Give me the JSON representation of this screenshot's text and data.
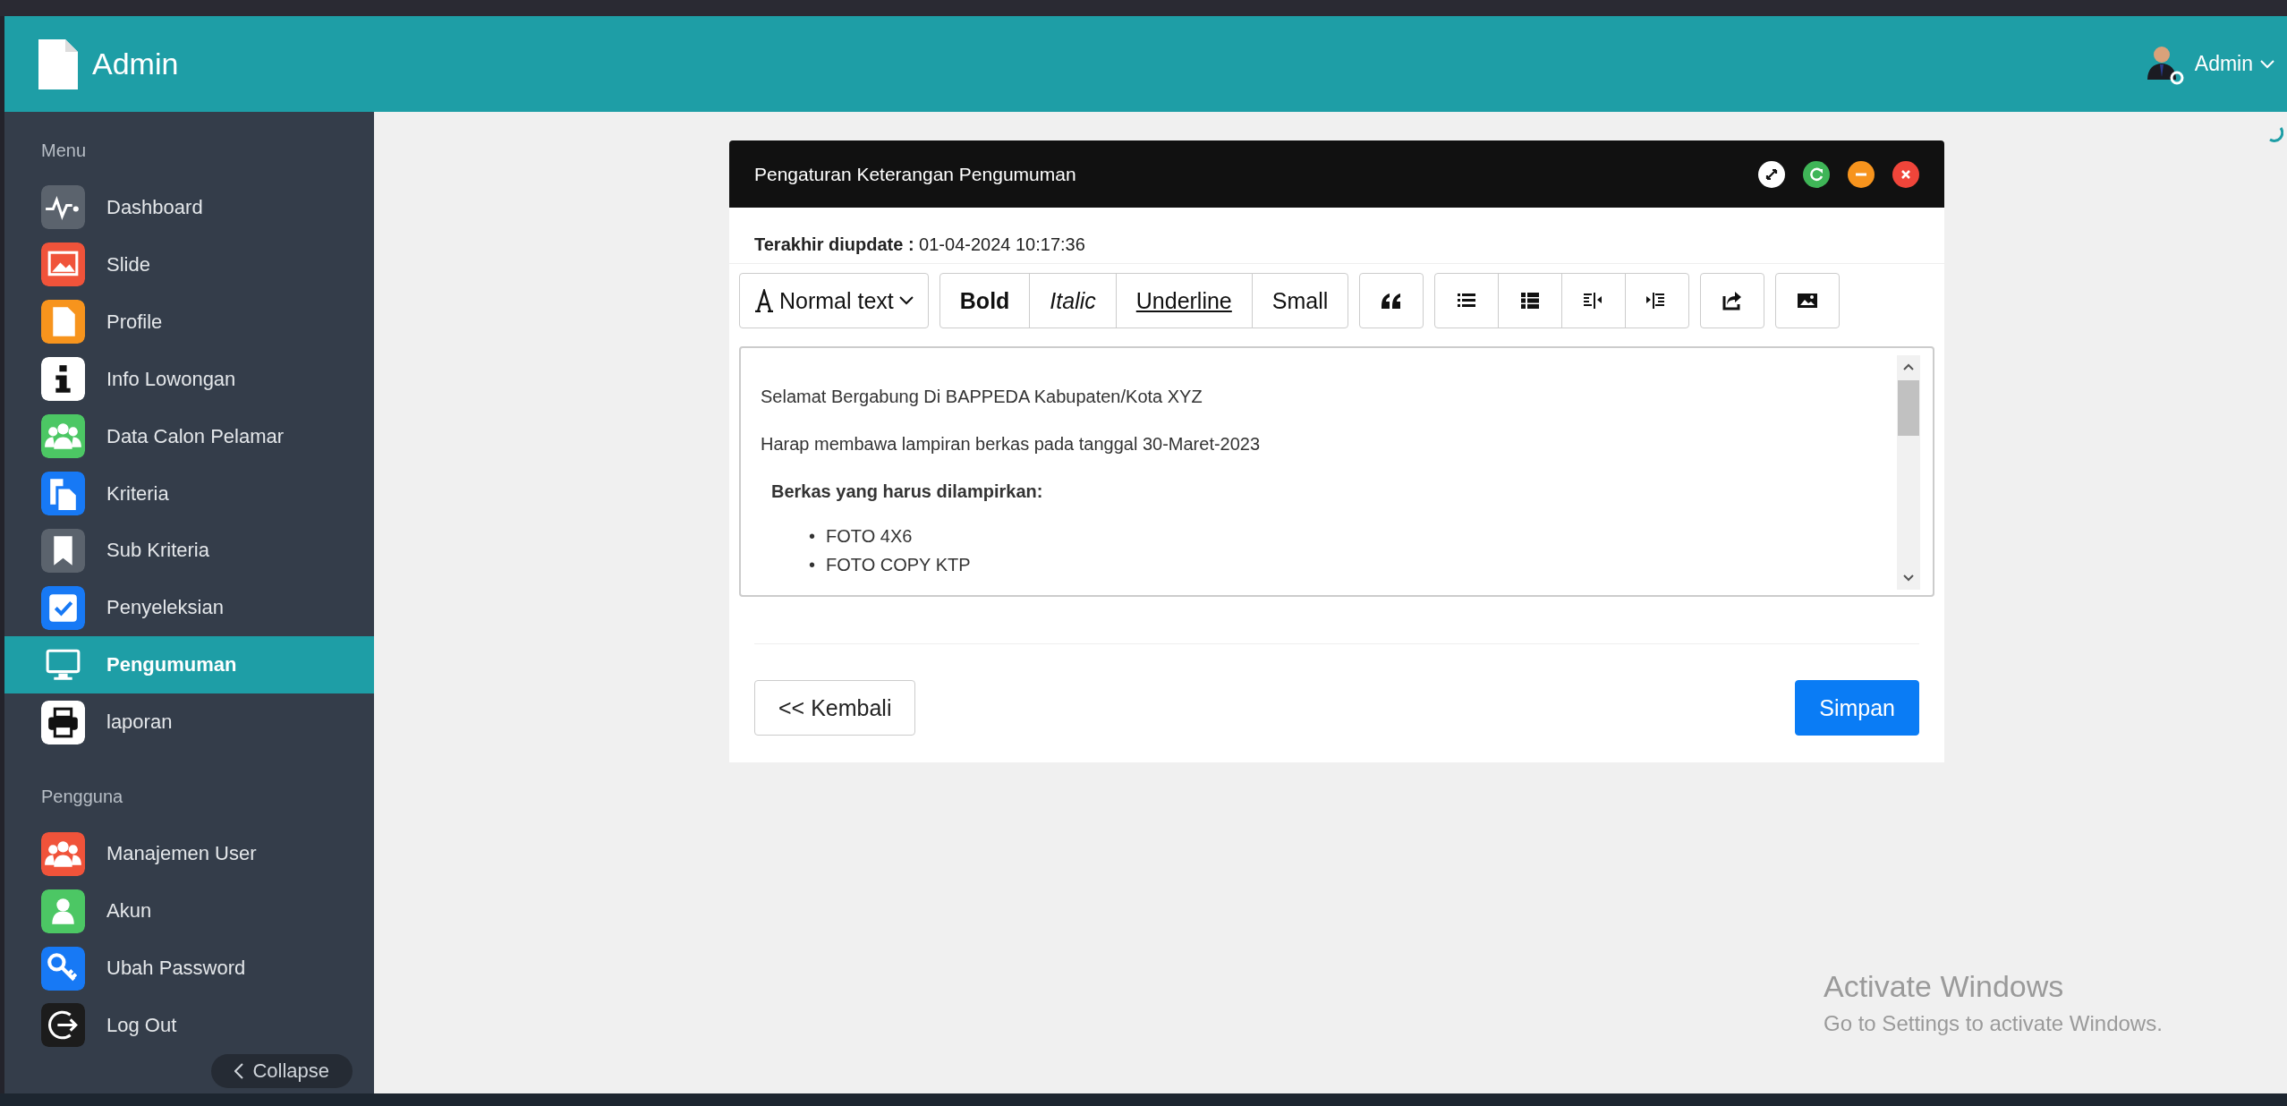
{
  "header": {
    "brand": "Admin",
    "user": "Admin"
  },
  "sidebar": {
    "sections": [
      {
        "title": "Menu",
        "items": [
          {
            "label": "Dashboard",
            "color": "#5b636d",
            "selected": false
          },
          {
            "label": "Slide",
            "color": "#f0533a",
            "selected": false
          },
          {
            "label": "Profile",
            "color": "#f7941d",
            "selected": false
          },
          {
            "label": "Info Lowongan",
            "color": "#ffffff",
            "selected": false
          },
          {
            "label": "Data Calon Pelamar",
            "color": "#4cc764",
            "selected": false
          },
          {
            "label": "Kriteria",
            "color": "#1779f5",
            "selected": false
          },
          {
            "label": "Sub Kriteria",
            "color": "#5b636d",
            "selected": false
          },
          {
            "label": "Penyeleksian",
            "color": "#1779f5",
            "selected": false
          },
          {
            "label": "Pengumuman",
            "selected": true
          },
          {
            "label": "laporan",
            "color": "#ffffff",
            "selected": false
          }
        ]
      },
      {
        "title": "Pengguna",
        "items": [
          {
            "label": "Manajemen User",
            "color": "#f0533a",
            "selected": false
          },
          {
            "label": "Akun",
            "color": "#4cc764",
            "selected": false
          },
          {
            "label": "Ubah Password",
            "color": "#1779f5",
            "selected": false
          },
          {
            "label": "Log Out",
            "color": "#1c1c1c",
            "selected": false
          }
        ]
      }
    ],
    "collapse": "Collapse"
  },
  "dialog": {
    "title": "Pengaturan Keterangan Pengumuman",
    "updated_label": "Terakhir diupdate :",
    "updated_value": "01-04-2024 10:17:36",
    "toolbar": {
      "format": "Normal text",
      "styles": [
        {
          "label": "Bold",
          "kind": "bold"
        },
        {
          "label": "Italic",
          "kind": "italic"
        },
        {
          "label": "Underline",
          "kind": "underline"
        },
        {
          "label": "Small",
          "kind": "plain"
        }
      ]
    },
    "content": [
      {
        "kind": "paragraph",
        "text": "Selamat Bergabung Di BAPPEDA Kabupaten/Kota XYZ"
      },
      {
        "kind": "paragraph",
        "text": "Harap membawa lampiran berkas pada tanggal 30-Maret-2023"
      },
      {
        "kind": "heading",
        "text": "Berkas yang harus dilampirkan:"
      },
      {
        "kind": "bullet",
        "marker": "•",
        "text": "FOTO 4X6"
      },
      {
        "kind": "bullet",
        "marker": "•",
        "text": "FOTO COPY KTP"
      }
    ],
    "back": "<< Kembali",
    "save": "Simpan"
  },
  "os_notice": {
    "title": "Activate Windows",
    "text": "Go to Settings to activate Windows."
  }
}
